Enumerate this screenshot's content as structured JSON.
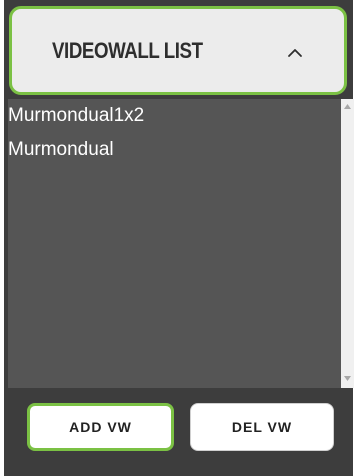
{
  "header": {
    "title": "VIDEOWALL LIST",
    "toggle_icon": "chevron-up-icon"
  },
  "list": {
    "items": [
      {
        "label": "Murmondual1x2"
      },
      {
        "label": "Murmondual"
      }
    ]
  },
  "footer": {
    "add_label": "ADD VW",
    "del_label": "DEL VW"
  },
  "colors": {
    "accent": "#7bc144",
    "panel_bg": "#3d3d3d",
    "list_bg": "#555555",
    "header_bg": "#ececec"
  }
}
